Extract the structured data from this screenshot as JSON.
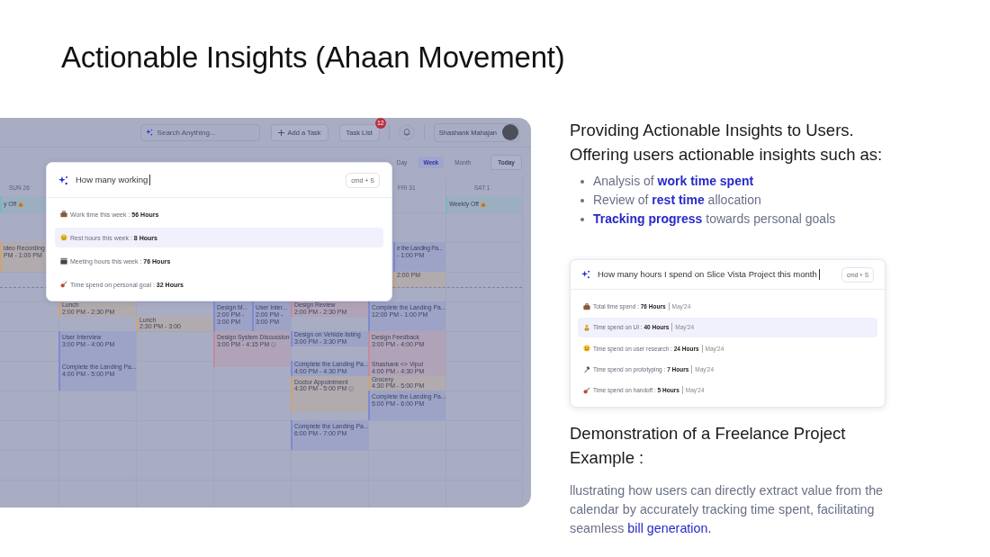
{
  "title": "Actionable Insights (Ahaan Movement)",
  "calendar": {
    "search": {
      "placeholder": "Search Anything..."
    },
    "add_task": "Add a Task",
    "task_list": {
      "label": "Task List",
      "badge": "12"
    },
    "user": {
      "name": "Shashank Mahajan"
    },
    "view_tabs": [
      {
        "label": "Day",
        "selected": false
      },
      {
        "label": "Week",
        "selected": true
      },
      {
        "label": "Month",
        "selected": false
      }
    ],
    "today": "Today",
    "day_headers": [
      "SUN 26",
      "FRI 31",
      "SAT 1"
    ],
    "events": [
      {
        "kind": "off",
        "title": "y Off",
        "color": "#7fb5bc"
      },
      {
        "kind": "off",
        "title": "Weekly Off",
        "color": "#7fb5bc"
      },
      {
        "kind": "event",
        "title": "ideo Recording",
        "time": "PM - 1:00 PM",
        "color": "#c9a57a"
      },
      {
        "kind": "event",
        "title": "e the Landing Pa...",
        "time": "- 1:00 PM",
        "color": "#7f8ad0"
      },
      {
        "kind": "event",
        "time": "2:00 PM",
        "color": "#c9a57a"
      },
      {
        "kind": "event",
        "title": "Lunch",
        "time": "2:00 PM - 2:30 PM",
        "color": "#c9a57a"
      },
      {
        "kind": "event",
        "title": "Lunch",
        "time": "2:30 PM - 3:00",
        "color": "#c9a57a"
      },
      {
        "kind": "event",
        "title": "Design M...",
        "time": "2:00 PM - 3:00 PM",
        "color": "#7f8ad0"
      },
      {
        "kind": "event",
        "title": "User Inter...",
        "time": "2:00 PM - 3:00 PM",
        "color": "#7f8ad0"
      },
      {
        "kind": "event",
        "title": "Design Review",
        "time": "2:00 PM - 2:30 PM",
        "color": "#c58a9c"
      },
      {
        "kind": "event",
        "title": "Complete the Landing Pa...",
        "time": "12:00 PM - 1:00 PM",
        "color": "#7f8ad0"
      },
      {
        "kind": "event",
        "title": "User Interview",
        "time": "3:00 PM - 4:00 PM",
        "color": "#7f8ad0"
      },
      {
        "kind": "event",
        "title": "Design System Discussion",
        "time": "3:00 PM - 4:15 PM",
        "color": "#c58a9c"
      },
      {
        "kind": "event",
        "title": "Design on Vehicle listing",
        "time": "3:00 PM - 3:30 PM",
        "color": "#7f8ad0"
      },
      {
        "kind": "event",
        "title": "Design Feedback",
        "time": "3:00 PM - 4:00 PM",
        "color": "#c58a9c"
      },
      {
        "kind": "event",
        "title": "Complete the Landing Pa...",
        "time": "4:00 PM - 5:00 PM",
        "color": "#7f8ad0"
      },
      {
        "kind": "event",
        "title": "Complete the Landing Pa...",
        "time": "4:00 PM - 4:30 PM",
        "color": "#7f8ad0"
      },
      {
        "kind": "event",
        "title": "Shashank <> Vipul",
        "time": "4:00 PM - 4:30 PM",
        "color": "#c58a9c"
      },
      {
        "kind": "event",
        "title": "Doctor Appointment",
        "time": "4:30 PM - 5:00 PM",
        "color": "#c9a57a"
      },
      {
        "kind": "event",
        "title": "Grocery",
        "time": "4:30 PM - 5:00 PM",
        "color": "#c9a57a"
      },
      {
        "kind": "event",
        "title": "Complete the Landing Pa...",
        "time": "5:00 PM - 6:00 PM",
        "color": "#7f8ad0"
      },
      {
        "kind": "event",
        "title": "Complete the Landing Pa...",
        "time": "6:00 PM - 7:00 PM",
        "color": "#7f8ad0"
      }
    ],
    "popup": {
      "query": "How many working",
      "shortcut": "cmd + S",
      "results": [
        {
          "text": "Work time this week : **56 Hours**",
          "selected": false
        },
        {
          "text": "Rest hours this week : **8 Hours**",
          "selected": true
        },
        {
          "text": "Meeting hours this week :  **76 Hours**",
          "selected": false
        },
        {
          "text": "Time spend on personal goal :  **32 Hours**",
          "selected": false
        }
      ]
    }
  },
  "insights": {
    "heading": [
      "Providing Actionable Insights to Users.",
      "Offering users actionable insights such as:"
    ],
    "bullets": [
      "Analysis of **work time spent**",
      "Review of **rest time** allocation",
      "**Tracking progress** towards personal goals"
    ],
    "example_card": {
      "query": "How many hours I spend on Slice Vista Project this month",
      "shortcut": "cmd + S",
      "results": [
        {
          "text": "Total time spend : **76 Hours**",
          "period": "May'24",
          "selected": false
        },
        {
          "text": "Time spend on UI : **40 Hours**",
          "period": "May'24",
          "selected": true
        },
        {
          "text": "Time spend on user research : **24 Hours**",
          "period": "May'24",
          "selected": false
        },
        {
          "text": "Time spend on prototyping : **7 Hours**",
          "period": "May'24",
          "selected": false
        },
        {
          "text": "Time spend on handoff : **5 Hours**",
          "period": "May'24",
          "selected": false
        }
      ]
    },
    "demo_heading": "Demonstration of a Freelance Project Example :",
    "demo_text": "llustrating how users can directly extract value from the calendar by accurately tracking time spent, facilitating seamless **bill generation.**"
  }
}
